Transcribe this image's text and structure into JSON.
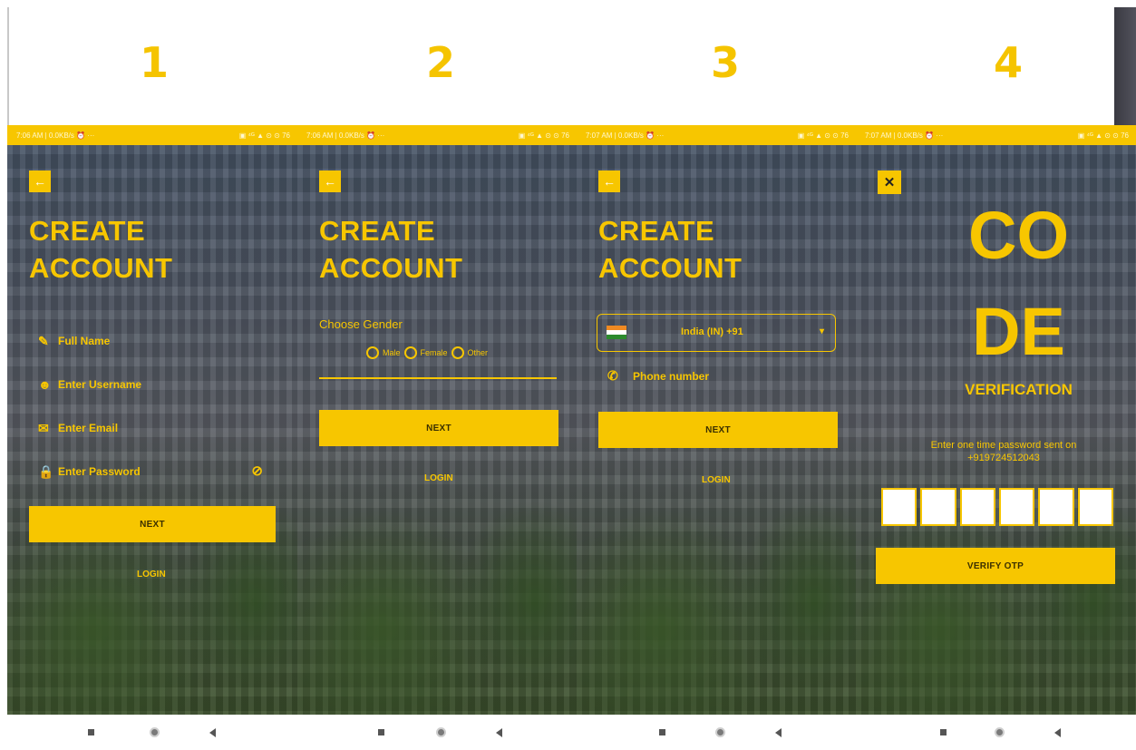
{
  "steps": {
    "s1": "1",
    "s2": "2",
    "s3": "3",
    "s4": "4"
  },
  "status_bar": {
    "left": "7:06 AM | 0.0KB/s ⏰ ···",
    "right": "▣ ⁴ᴳ ▲ ⊙ ⊙ 76"
  },
  "status_bar_3": {
    "left": "7:07 AM | 0.0KB/s ⏰ ···",
    "right": "▣ ⁴ᴳ ▲ ⊙ ⊙ 76"
  },
  "screen1": {
    "title_line1": "CREATE",
    "title_line2": "ACCOUNT",
    "fields": {
      "full_name": "Full Name",
      "username": "Enter Username",
      "email": "Enter Email",
      "password": "Enter Password"
    },
    "next_label": "NEXT",
    "login_label": "LOGIN"
  },
  "screen2": {
    "title_line1": "CREATE",
    "title_line2": "ACCOUNT",
    "gender_label": "Choose Gender",
    "options": {
      "male": "Male",
      "female": "Female",
      "other": "Other"
    },
    "next_label": "NEXT",
    "login_label": "LOGIN"
  },
  "screen3": {
    "title_line1": "CREATE",
    "title_line2": "ACCOUNT",
    "country_value": "India (IN)  +91",
    "phone_placeholder": "Phone number",
    "next_label": "NEXT",
    "login_label": "LOGIN"
  },
  "screen4": {
    "code_line1": "CO",
    "code_line2": "DE",
    "verification": "VERIFICATION",
    "otp_info_line1": "Enter one time password sent on",
    "otp_info_line2": "+919724512043",
    "verify_label": "VERIFY OTP"
  },
  "icons": {
    "back": "←",
    "close": "✕",
    "pencil": "✎",
    "user": "☻",
    "mail": "✉",
    "lock": "🔒",
    "eye": "⊘",
    "phone": "✆",
    "dropdown": "▾"
  },
  "colors": {
    "accent": "#f7c600",
    "nav": "#555555"
  }
}
